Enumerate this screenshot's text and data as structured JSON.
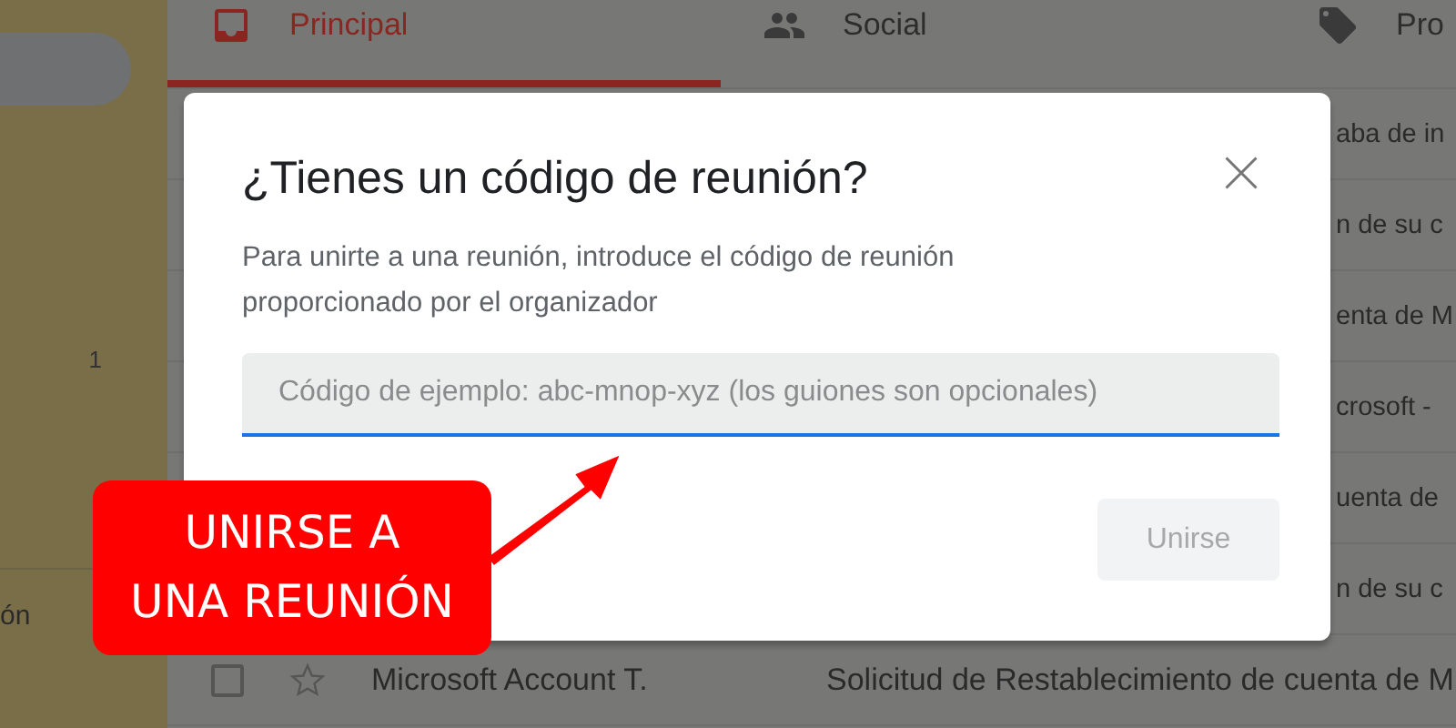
{
  "sidebar": {
    "items": [
      {
        "kind": "count",
        "text": "1"
      },
      {
        "kind": "label",
        "text": "ón"
      }
    ]
  },
  "tabs": [
    {
      "label": "Principal",
      "selected": true
    },
    {
      "label": "Social",
      "selected": false
    },
    {
      "label": "Pro",
      "selected": false
    }
  ],
  "rows": [
    {
      "kind": "partial",
      "text": "aba de in"
    },
    {
      "kind": "partial",
      "text": "n de su c"
    },
    {
      "kind": "partial",
      "text": "enta de M"
    },
    {
      "kind": "partial",
      "text": "crosoft -"
    },
    {
      "kind": "partial",
      "text": "uenta de"
    },
    {
      "kind": "partial",
      "text": "n de su c"
    },
    {
      "kind": "full",
      "checked": false,
      "starred": false,
      "sender": "Microsoft Account T.",
      "subject": "Solicitud de Restablecimiento de cuenta de M"
    }
  ],
  "dialog": {
    "title": "¿Tienes un código de reunión?",
    "description": "Para unirte a una reunión, introduce el código de reunión proporcionado por el organizador",
    "input": {
      "placeholder": "Código de ejemplo: abc-mnop-xyz (los guiones son opcionales)"
    },
    "button": {
      "label": "Unirse",
      "disabled": true
    }
  },
  "callout": {
    "lines": [
      "UNIRSE A",
      "UNA REUNIÓN"
    ]
  }
}
